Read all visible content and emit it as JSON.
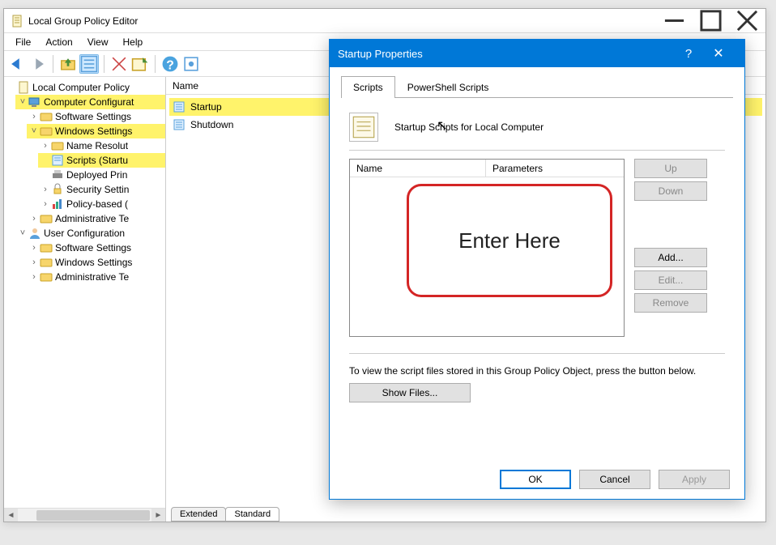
{
  "window": {
    "title": "Local Group Policy Editor"
  },
  "menu": {
    "file": "File",
    "action": "Action",
    "view": "View",
    "help": "Help"
  },
  "tree": {
    "root": "Local Computer Policy",
    "comp_conf": "Computer Configurat",
    "sw_settings1": "Software Settings",
    "win_settings1": "Windows Settings",
    "name_res": "Name Resolut",
    "scripts": "Scripts (Startu",
    "deployed": "Deployed Prin",
    "security": "Security Settin",
    "policy_qos": "Policy-based (",
    "admin_tmpl1": "Administrative Te",
    "user_conf": "User Configuration",
    "sw_settings2": "Software Settings",
    "win_settings2": "Windows Settings",
    "admin_tmpl2": "Administrative Te"
  },
  "list": {
    "header": "Name",
    "startup": "Startup",
    "shutdown": "Shutdown"
  },
  "bottom_tabs": {
    "extended": "Extended",
    "standard": "Standard"
  },
  "dialog": {
    "title": "Startup Properties",
    "tab_scripts": "Scripts",
    "tab_ps": "PowerShell Scripts",
    "subtitle": "Startup Scripts for Local Computer",
    "col_name": "Name",
    "col_params": "Parameters",
    "btn_up": "Up",
    "btn_down": "Down",
    "btn_add": "Add...",
    "btn_edit": "Edit...",
    "btn_remove": "Remove",
    "hint": "To view the script files stored in this Group Policy Object, press the button below.",
    "show_files": "Show Files...",
    "ok": "OK",
    "cancel": "Cancel",
    "apply": "Apply"
  },
  "annotation": {
    "label": "Enter Here"
  }
}
